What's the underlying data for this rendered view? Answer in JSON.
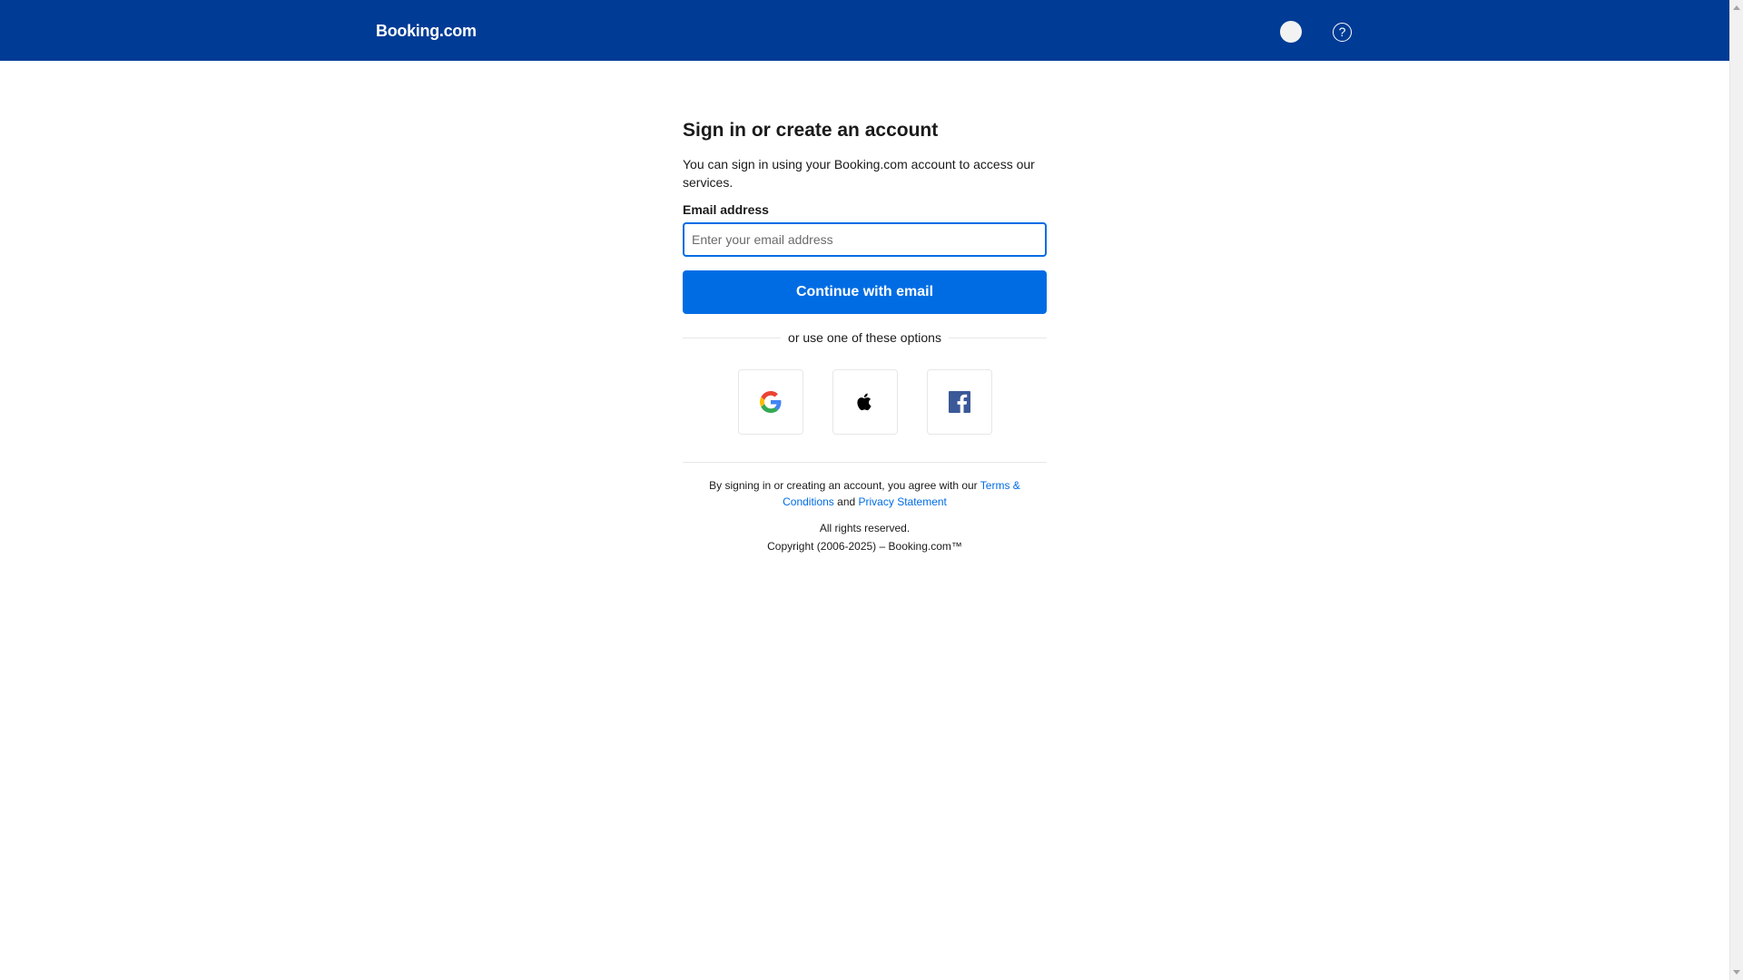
{
  "header": {
    "logo": "Booking.com",
    "help_icon": "?"
  },
  "signin": {
    "title": "Sign in or create an account",
    "description": "You can sign in using your Booking.com account to access our services.",
    "email_label": "Email address",
    "email_placeholder": "Enter your email address",
    "email_value": "",
    "continue_label": "Continue with email",
    "divider_text": "or use one of these options",
    "social": [
      "google-icon",
      "apple-icon",
      "facebook-icon"
    ]
  },
  "footer": {
    "legal_prefix": "By signing in or creating an account, you agree with our ",
    "terms_link": "Terms & Conditions",
    "and": " and ",
    "privacy_link": "Privacy Statement",
    "rights": "All rights reserved.",
    "copyright": "Copyright (2006-2025) – Booking.com™"
  },
  "colors": {
    "header": "#003b95",
    "primary": "#006ce4"
  }
}
